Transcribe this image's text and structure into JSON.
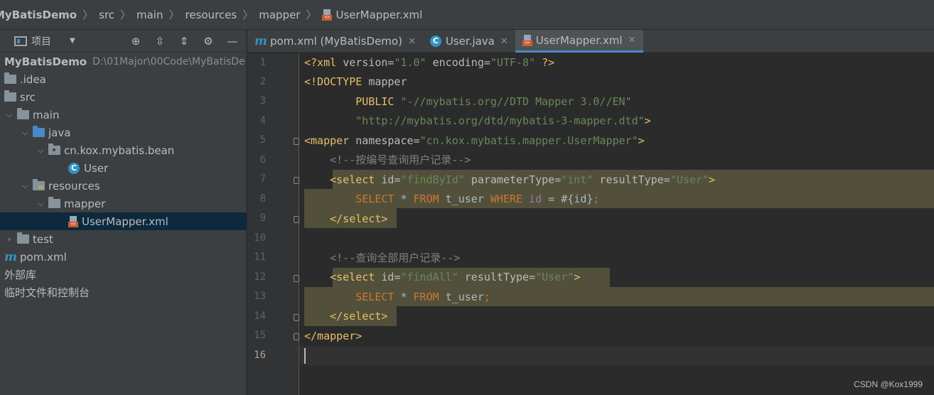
{
  "breadcrumb": {
    "project": "MyBatisDemo",
    "items": [
      "src",
      "main",
      "resources",
      "mapper"
    ],
    "file": "UserMapper.xml"
  },
  "project_panel": {
    "title": "项目",
    "tools": [
      "locate-icon",
      "expand-all-icon",
      "collapse-all-icon",
      "gear-icon",
      "minimize-icon"
    ],
    "tree": [
      {
        "label": "MyBatisDemo",
        "path": "D:\\01Major\\00Code\\MyBatisDe",
        "type": "project"
      },
      {
        "label": ".idea",
        "type": "folder"
      },
      {
        "label": "src",
        "type": "folder"
      },
      {
        "label": "main",
        "type": "folder"
      },
      {
        "label": "java",
        "type": "source-folder"
      },
      {
        "label": "cn.kox.mybatis.bean",
        "type": "package"
      },
      {
        "label": "User",
        "type": "class"
      },
      {
        "label": "resources",
        "type": "resource-folder"
      },
      {
        "label": "mapper",
        "type": "folder"
      },
      {
        "label": "UserMapper.xml",
        "type": "xml-file"
      },
      {
        "label": "test",
        "type": "folder"
      },
      {
        "label": "pom.xml",
        "type": "maven-file"
      },
      {
        "label": "外部库",
        "type": "plain"
      },
      {
        "label": "临时文件和控制台",
        "type": "plain"
      }
    ]
  },
  "tabs": [
    {
      "label": "pom.xml (MyBatisDemo)",
      "icon": "maven-icon"
    },
    {
      "label": "User.java",
      "icon": "class-icon"
    },
    {
      "label": "UserMapper.xml",
      "icon": "xml-icon",
      "active": true
    }
  ],
  "editor": {
    "line_numbers": [
      "1",
      "2",
      "3",
      "4",
      "5",
      "6",
      "7",
      "8",
      "9",
      "10",
      "11",
      "12",
      "13",
      "14",
      "15",
      "16"
    ],
    "current_line": 16,
    "lines": {
      "l1": {
        "a": "<?xml ",
        "b": "version",
        "c": "=",
        "d": "\"1.0\"",
        "e": " encoding",
        "f": "=",
        "g": "\"UTF-8\"",
        "h": " ?>"
      },
      "l2": {
        "a": "<!DOCTYPE ",
        "b": "mapper"
      },
      "l3": {
        "a": "        PUBLIC ",
        "b": "\"-//mybatis.org//DTD Mapper 3.0//EN\""
      },
      "l4": {
        "a": "        ",
        "b": "\"http://mybatis.org/dtd/mybatis-3-mapper.dtd\"",
        "c": ">"
      },
      "l5": {
        "a": "<mapper ",
        "b": "namespace",
        "c": "=",
        "d": "\"cn.kox.mybatis.mapper.UserMapper\"",
        "e": ">"
      },
      "l6": {
        "a": "    <!--按编号查询用户记录-->"
      },
      "l7": {
        "a": "    <select ",
        "b": "id",
        "c": "=",
        "d": "\"findById\"",
        "e": " parameterType",
        "f": "=",
        "g": "\"int\"",
        "h": " resultType",
        "i": "=",
        "j": "\"User\"",
        "k": ">"
      },
      "l8": {
        "a": "        ",
        "b": "SELECT",
        "c": " * ",
        "d": "FROM",
        "e": " t_user ",
        "f": "WHERE",
        "g": " id",
        "h": " = #{id}",
        "i": ";"
      },
      "l9": {
        "a": "    </select>"
      },
      "l11": {
        "a": "    <!--查询全部用户记录-->"
      },
      "l12": {
        "a": "    <select ",
        "b": "id",
        "c": "=",
        "d": "\"findAll\"",
        "e": " resultType",
        "f": "=",
        "g": "\"User\"",
        "h": ">"
      },
      "l13": {
        "a": "        ",
        "b": "SELECT",
        "c": " * ",
        "d": "FROM",
        "e": " t_user",
        "f": ";"
      },
      "l14": {
        "a": "    </select>"
      },
      "l15": {
        "a": "</mapper>"
      }
    }
  },
  "watermark": "CSDN @Kox1999",
  "colors": {
    "accent": "#4a88c7",
    "highlight": "#52503a",
    "tag": "#e8bf6a",
    "string": "#6a8759",
    "keyword": "#cc7832"
  }
}
